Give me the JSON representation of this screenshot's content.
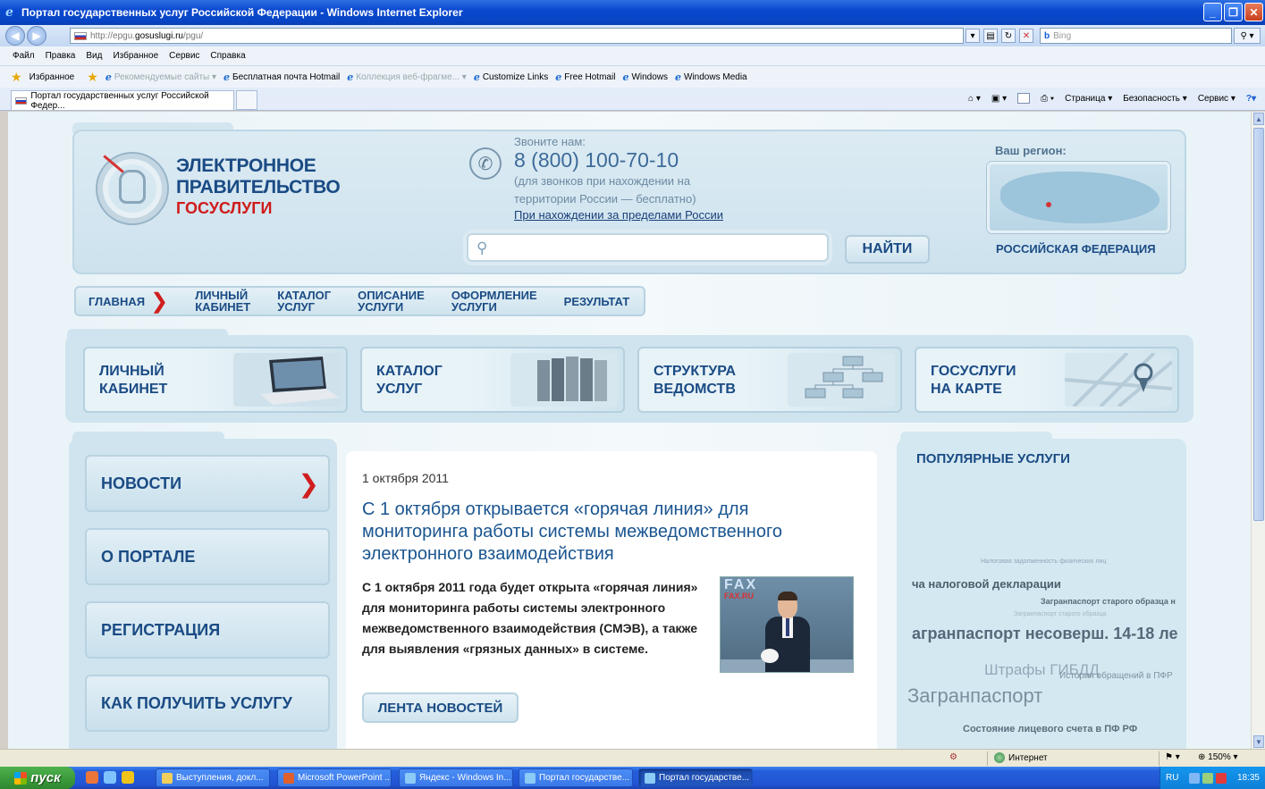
{
  "window": {
    "title": "Портал государственных услуг Российской Федерации - Windows Internet Explorer",
    "address_prefix": "http://epgu.",
    "address_host": "gosuslugi.ru",
    "address_path": "/pgu/",
    "search_placeholder": "Bing",
    "search_provider_icon": "b"
  },
  "menu": [
    "Файл",
    "Правка",
    "Вид",
    "Избранное",
    "Сервис",
    "Справка"
  ],
  "favorites": {
    "label": "Избранное",
    "items": [
      {
        "label": "Рекомендуемые сайты ▾",
        "dim": true
      },
      {
        "label": "Бесплатная почта Hotmail",
        "dim": false
      },
      {
        "label": "Коллекция веб-фрагме... ▾",
        "dim": true
      },
      {
        "label": "Customize Links",
        "dim": false
      },
      {
        "label": "Free Hotmail",
        "dim": false
      },
      {
        "label": "Windows",
        "dim": false
      },
      {
        "label": "Windows Media",
        "dim": false
      }
    ]
  },
  "tab": {
    "label": "Портал государственных услуг Российской Федер..."
  },
  "command_bar": {
    "page": "Страница ▾",
    "safety": "Безопасность ▾",
    "tools": "Сервис ▾"
  },
  "portal": {
    "logo_line1": "ЭЛЕКТРОННОЕ",
    "logo_line2": "ПРАВИТЕЛЬСТВО",
    "logo_line3": "ГОСУСЛУГИ",
    "call_label": "Звоните нам:",
    "phone": "8 (800) 100-70-10",
    "phone_note": "(для звонков при нахождении на территории России — бесплатно)",
    "abroad_link": "При нахождении за пределами России",
    "search_button": "НАЙТИ",
    "region_label": "Ваш регион:",
    "region_name": "РОССИЙСКАЯ ФЕДЕРАЦИЯ"
  },
  "breadcrumbs": [
    {
      "line1": "ГЛАВНАЯ",
      "line2": ""
    },
    {
      "line1": "ЛИЧНЫЙ",
      "line2": "КАБИНЕТ"
    },
    {
      "line1": "КАТАЛОГ",
      "line2": "УСЛУГ"
    },
    {
      "line1": "ОПИСАНИЕ",
      "line2": "УСЛУГИ"
    },
    {
      "line1": "ОФОРМЛЕНИЕ",
      "line2": "УСЛУГИ"
    },
    {
      "line1": "РЕЗУЛЬТАТ",
      "line2": ""
    }
  ],
  "tiles": [
    {
      "line1": "ЛИЧНЫЙ",
      "line2": "КАБИНЕТ"
    },
    {
      "line1": "КАТАЛОГ",
      "line2": "УСЛУГ"
    },
    {
      "line1": "СТРУКТУРА",
      "line2": "ВЕДОМСТВ"
    },
    {
      "line1": "ГОСУСЛУГИ",
      "line2": "НА КАРТЕ"
    }
  ],
  "left_menu": [
    "НОВОСТИ",
    "О ПОРТАЛЕ",
    "РЕГИСТРАЦИЯ",
    "КАК ПОЛУЧИТЬ УСЛУГУ"
  ],
  "news": {
    "date": "1 октября 2011",
    "title": "С 1 октября открывается «горячая линия» для мониторинга работы системы межведомственного электронного взаимодействия",
    "body": "С 1 октября 2011 года будет открыта «горячая линия» для мониторинга работы системы электронного межведомственного взаимодействия (СМЭВ), а также для выявления «грязных данных» в системе.",
    "photo_text1": "FAX",
    "photo_text2": "FAX.RU",
    "more_button": "ЛЕНТА НОВОСТЕЙ"
  },
  "popular": {
    "title": "ПОПУЛЯРНЫЕ УСЛУГИ",
    "tags": [
      "Налоговая задолженность физических лиц",
      "ча налоговой декларации",
      "Загранпаспорт старого образца н",
      "Загранпаспорт старого образца",
      "агранпаспорт несоверш. 14-18 ле",
      "Штрафы ГИБДД",
      "История обращений в ПФР",
      "Загранпаспорт",
      "Состояние лицевого счета в ПФ РФ"
    ]
  },
  "statusbar": {
    "zone": "Интернет",
    "zoom": "150%"
  },
  "taskbar": {
    "start": "пуск",
    "tasks": [
      "Выступления, докл...",
      "Microsoft PowerPoint ...",
      "Яндекс - Windows In...",
      "Портал государстве...",
      "Портал государстве..."
    ],
    "lang": "RU",
    "clock": "18:35"
  }
}
